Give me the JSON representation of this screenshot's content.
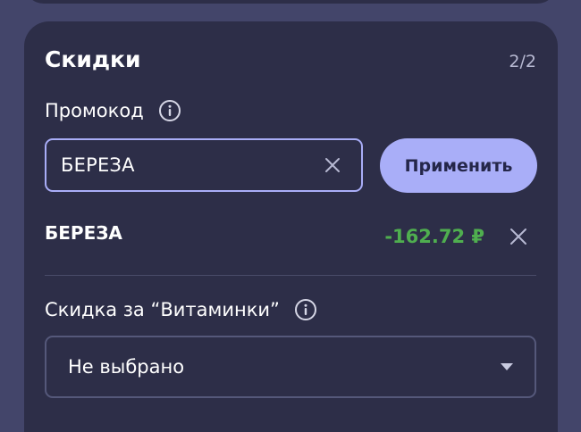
{
  "discounts": {
    "title": "Скидки",
    "counter": "2/2",
    "promo": {
      "label": "Промокод",
      "input_value": "БЕРЕЗА",
      "apply_label": "Применить",
      "applied_code": "БЕРЕЗА",
      "applied_amount": "-162.72 ₽"
    },
    "vitamin": {
      "label": "Скидка за “Витаминки”",
      "selected": "Не выбрано"
    }
  },
  "colors": {
    "background": "#43456a",
    "card": "#2d2e48",
    "accent": "#a9aef8",
    "discount_green": "#4fae4f"
  },
  "icons": {
    "info": "info-circle-icon",
    "clear": "close-icon",
    "dropdown": "caret-down-icon"
  }
}
